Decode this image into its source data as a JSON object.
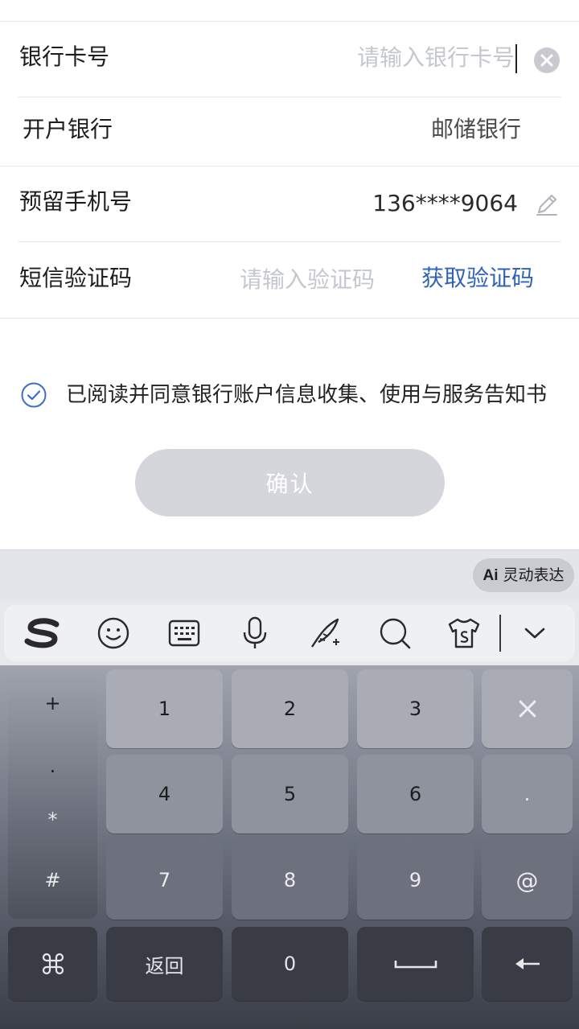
{
  "form": {
    "rows": [
      {
        "label": "银行卡号",
        "value": "请输入银行卡号"
      },
      {
        "label": "开户银行",
        "value": "邮储银行"
      },
      {
        "label": "预留手机号",
        "value": "136****9064"
      },
      {
        "label": "短信验证码",
        "value": "请输入验证码",
        "action": "获取验证码"
      }
    ],
    "agreement": "已阅读并同意银行账户信息收集、使用与服务告知书",
    "confirm": "确认"
  },
  "keyboard": {
    "ai_chip": {
      "prefix": "Ai",
      "label": "灵动表达"
    },
    "toolbar_icons": [
      "sogou-logo-icon",
      "emoji-icon",
      "keyboard-icon",
      "microphone-icon",
      "handwriting-icon",
      "search-icon",
      "skin-icon",
      "chevron-down-icon"
    ],
    "side_symbols": [
      "+",
      ".",
      "*",
      "#"
    ],
    "keys": {
      "k1": "1",
      "k2": "2",
      "k3": "3",
      "k4": "4",
      "k5": "5",
      "k6": "6",
      "dot": ".",
      "k7": "7",
      "k8": "8",
      "k9": "9",
      "at": "@",
      "back": "返回",
      "k0": "0"
    },
    "icons": [
      "delete-icon",
      "command-icon",
      "space-icon",
      "backspace-icon"
    ]
  },
  "colors": {
    "link": "#2f63b8",
    "placeholder": "#c4c7cd",
    "confirm_bg": "#d4d6dc"
  }
}
